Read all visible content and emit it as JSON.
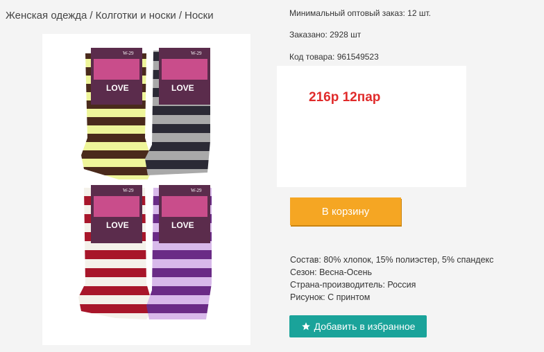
{
  "breadcrumb": {
    "items": [
      "Женская одежда",
      "Колготки и носки",
      "Носки"
    ],
    "separator": "/"
  },
  "product": {
    "min_order": "Минимальный оптовый заказ: 12 шт.",
    "ordered": "Заказано: 2928 шт",
    "sku": "Код товара: 961549523",
    "price_label": "216р 12пар",
    "image_labels": {
      "brand": "LOVE",
      "size": "W-29"
    }
  },
  "buttons": {
    "cart": "В корзину",
    "favorite": "Добавить в избранное"
  },
  "attributes": [
    "Состав: 80% хлопок, 15% полиэстер, 5% спандекс",
    "Сезон: Весна-Осень",
    "Страна-производитель: Россия",
    "Рисунок: С принтом"
  ],
  "colors": {
    "price": "#e02b2b",
    "cart_button": "#f5a623",
    "favorite_button": "#1aa39a"
  },
  "icons": {
    "favorite": "star-icon"
  }
}
